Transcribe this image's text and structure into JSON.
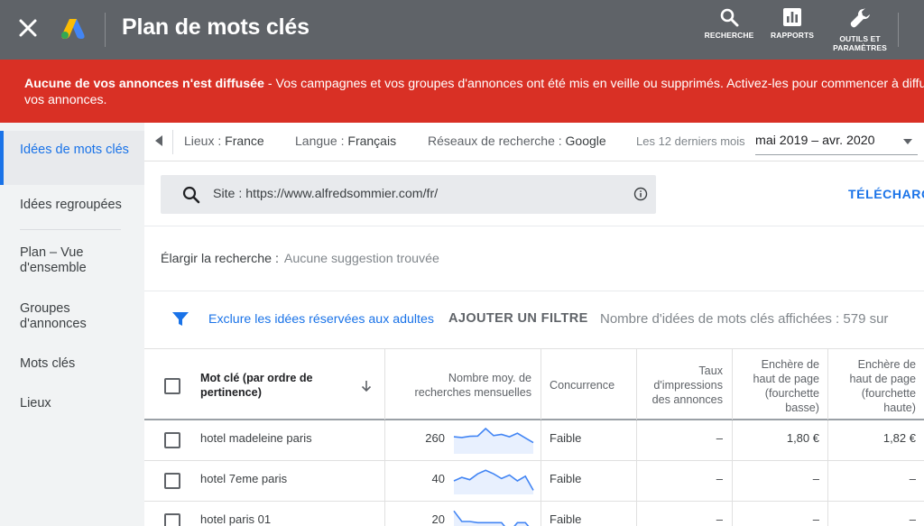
{
  "header": {
    "title": "Plan de mots clés",
    "tools": [
      {
        "label": "RECHERCHE",
        "icon": "search-icon"
      },
      {
        "label": "RAPPORTS",
        "icon": "bar-chart-icon"
      },
      {
        "label": "OUTILS ET",
        "label2": "PARAMÈTRES",
        "icon": "wrench-icon"
      }
    ]
  },
  "banner": {
    "bold": "Aucune de vos annonces n'est diffusée",
    "rest": " - Vos campagnes et vos groupes d'annonces ont été mis en veille ou supprimés. Activez-les pour commencer à diffuser",
    "line2": "vos annonces."
  },
  "sidebar": {
    "items": [
      {
        "label": "Idées de mots clés",
        "active": true
      },
      {
        "label": "Idées regroupées"
      },
      {
        "label": "Plan – Vue d'ensemble"
      },
      {
        "label": "Groupes d'annonces"
      },
      {
        "label": "Mots clés"
      },
      {
        "label": "Lieux"
      }
    ]
  },
  "filters": {
    "lieux_label": "Lieux : ",
    "lieux_value": "France",
    "langue_label": "Langue : ",
    "langue_value": "Français",
    "reseaux_label": "Réseaux de recherche : ",
    "reseaux_value": "Google",
    "period_label": "Les 12 derniers mois",
    "date_range": "mai 2019 – avr. 2020"
  },
  "search": {
    "text": "Site : https://www.alfredsommier.com/fr/",
    "download": "TÉLÉCHARG"
  },
  "broaden": {
    "label": "Élargir la recherche :",
    "value": "Aucune suggestion trouvée"
  },
  "filter_row": {
    "exclude": "Exclure les idées réservées aux adultes",
    "add_filter": "AJOUTER UN FILTRE",
    "count": "Nombre d'idées de mots clés affichées : 579 sur"
  },
  "table": {
    "columns": {
      "keyword": [
        "Mot clé (par ordre de",
        "pertinence)"
      ],
      "searches": [
        "Nombre moy. de",
        "recherches mensuelles"
      ],
      "competition": [
        "Concurrence"
      ],
      "impressions": [
        "Taux",
        "d'impressions",
        "des annonces"
      ],
      "bid_low": [
        "Enchère de",
        "haut de page",
        "(fourchette",
        "basse)"
      ],
      "bid_high": [
        "Enchère de",
        "haut de page",
        "(fourchette",
        "haute)"
      ]
    },
    "rows": [
      {
        "keyword": "hotel madeleine paris",
        "searches": "260",
        "competition": "Faible",
        "impressions": "–",
        "bid_low": "1,80 €",
        "bid_high": "1,82 €",
        "trend": [
          0.35,
          0.38,
          0.33,
          0.32,
          0.0,
          0.3,
          0.25,
          0.35,
          0.2,
          0.4,
          0.6
        ]
      },
      {
        "keyword": "hotel 7eme paris",
        "searches": "40",
        "competition": "Faible",
        "impressions": "–",
        "bid_low": "–",
        "bid_high": "–",
        "trend": [
          0.5,
          0.35,
          0.45,
          0.2,
          0.05,
          0.2,
          0.4,
          0.25,
          0.5,
          0.3,
          0.9
        ]
      },
      {
        "keyword": "hotel paris 01",
        "searches": "20",
        "competition": "Faible",
        "impressions": "–",
        "bid_low": "–",
        "bid_high": "–",
        "trend": [
          0.05,
          0.5,
          0.5,
          0.55,
          0.55,
          0.55,
          0.55,
          0.95,
          0.55,
          0.55,
          0.95
        ]
      }
    ]
  },
  "colors": {
    "header": "#5f6368",
    "banner": "#d93025",
    "accent": "#1a73e8",
    "sparkline": "#4285f4"
  }
}
